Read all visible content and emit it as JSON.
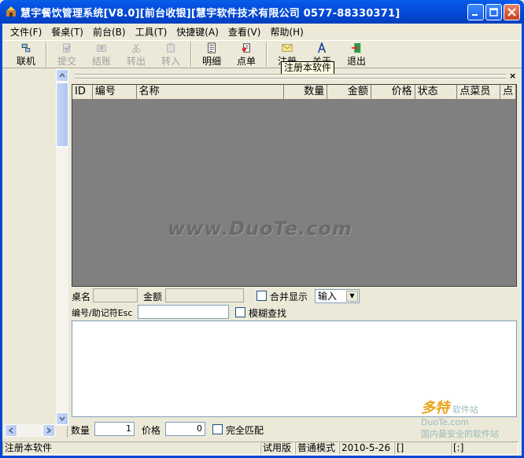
{
  "window": {
    "title": "慧宇餐饮管理系统[V8.0][前台收银][慧宇软件技术有限公司 0577-88330371]"
  },
  "menu": [
    "文件(F)",
    "餐桌(T)",
    "前台(B)",
    "工具(T)",
    "快捷键(A)",
    "查看(V)",
    "帮助(H)"
  ],
  "toolbar": {
    "buttons": [
      {
        "label": "联机",
        "icon": "connect-icon",
        "enabled": true
      },
      {
        "label": "提交",
        "icon": "submit-icon",
        "enabled": false
      },
      {
        "label": "结账",
        "icon": "checkout-icon",
        "enabled": false
      },
      {
        "label": "转出",
        "icon": "cut-icon",
        "enabled": false
      },
      {
        "label": "转入",
        "icon": "paste-icon",
        "enabled": false
      },
      {
        "label": "明细",
        "icon": "detail-icon",
        "enabled": true
      },
      {
        "label": "点单",
        "icon": "order-icon",
        "enabled": true
      },
      {
        "label": "注册",
        "icon": "register-icon",
        "enabled": true
      },
      {
        "label": "关于",
        "icon": "about-icon",
        "enabled": true
      },
      {
        "label": "退出",
        "icon": "exit-icon",
        "enabled": true
      }
    ],
    "tooltip": "注册本软件"
  },
  "grid": {
    "columns": [
      "ID",
      "编号",
      "名称",
      "数量",
      "金额",
      "价格",
      "状态",
      "点菜员",
      "点"
    ]
  },
  "watermark": "www.DuoTe.com",
  "form": {
    "table_label": "桌名",
    "amount_label": "金额",
    "merge_label": "合并显示",
    "mode_value": "输入",
    "code_label": "编号/助记符Esc",
    "fuzzy_label": "模糊查找",
    "qty_label": "数量",
    "qty_value": "1",
    "price_label": "价格",
    "price_value": "0",
    "exact_label": "完全匹配"
  },
  "status": {
    "message": "注册本软件",
    "edition": "试用版",
    "mode": "普通模式",
    "date": "2010-5-26",
    "cell4": "[]",
    "cell5": "[:]"
  },
  "logo_watermark": {
    "brand": "多特",
    "brand_suffix": "软件站",
    "site": "DuoTe.com",
    "slogan": "国内最安全的软件站"
  },
  "colors": {
    "titlebar": "#0348d4",
    "grid_bg": "#808080",
    "face": "#ece9d8"
  }
}
